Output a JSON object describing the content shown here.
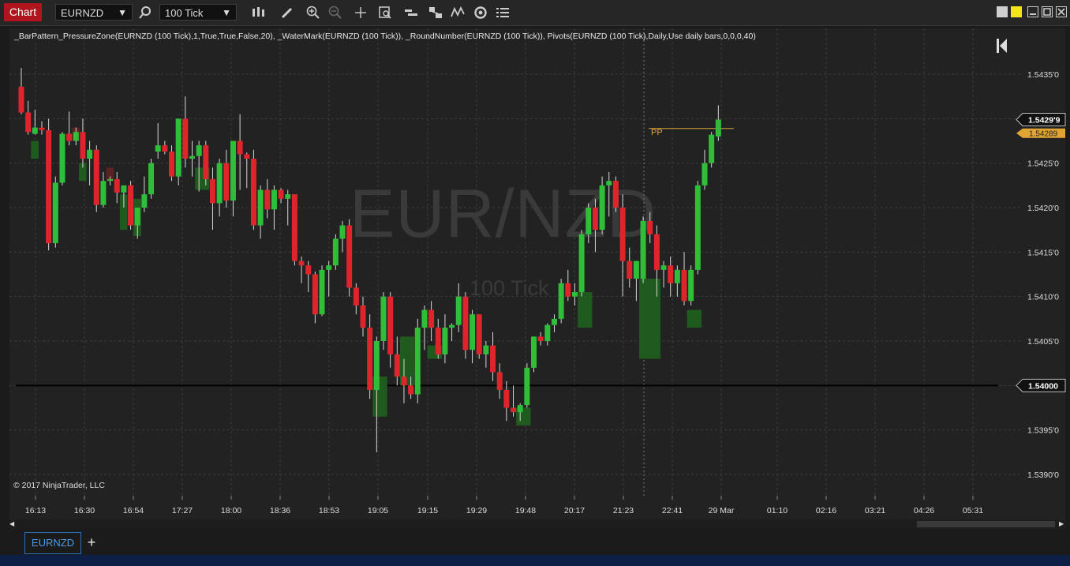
{
  "toolbar": {
    "chart_tab_label": "Chart",
    "instrument": "EURNZD",
    "interval": "100 Tick",
    "icons": [
      "search-icon",
      "bar-type-icon",
      "pencil-icon",
      "zoom-in-icon",
      "zoom-out-icon",
      "crosshair-icon",
      "data-box-icon",
      "indicators-icon",
      "strategies-icon",
      "chart-trader-icon",
      "refresh-icon",
      "properties-icon"
    ]
  },
  "chart": {
    "indicator_line": "_BarPattern_PressureZone(EURNZD (100 Tick),1,True,True,False,20), _WaterMark(EURNZD (100 Tick)), _RoundNumber(EURNZD (100 Tick)), Pivots(EURNZD (100 Tick),Daily,Use daily bars,0,0,0,40)",
    "watermark_symbol": "EUR/NZD",
    "watermark_interval": "100 Tick",
    "copyright": "© 2017 NinjaTrader, LLC",
    "pivot_label": "PP",
    "price_labels": [
      "1.5435'0",
      "1.5425'0",
      "1.5420'0",
      "1.5415'0",
      "1.5410'0",
      "1.5405'0",
      "1.5395'0",
      "1.5390'0"
    ],
    "current_price_label": "1.5429'9",
    "pivot_price_label": "1.54289",
    "round_number_label": "1.54000",
    "time_labels": [
      "16:13",
      "16:30",
      "16:54",
      "17:27",
      "18:00",
      "18:36",
      "18:53",
      "19:05",
      "19:15",
      "19:29",
      "19:48",
      "20:17",
      "21:23",
      "22:41",
      "29 Mar",
      "01:10",
      "02:16",
      "03:21",
      "04:26",
      "05:31"
    ],
    "colors": {
      "up": "#2fbe3a",
      "down": "#e0242b",
      "zone_up": "#1f5a1f",
      "zone_down": "#5a2222",
      "pivot": "#e0a533",
      "round_number": "#000000"
    }
  },
  "chart_data": {
    "type": "candlestick",
    "ylim": [
      1.5387,
      1.544
    ],
    "candles": [
      {
        "o": 1.54336,
        "h": 1.54357,
        "l": 1.54305,
        "c": 1.54307
      },
      {
        "o": 1.54307,
        "h": 1.5432,
        "l": 1.54282,
        "c": 1.54285
      },
      {
        "o": 1.54283,
        "h": 1.5431,
        "l": 1.54282,
        "c": 1.5429
      },
      {
        "o": 1.5429,
        "h": 1.54297,
        "l": 1.54282,
        "c": 1.54287
      },
      {
        "o": 1.54287,
        "h": 1.543,
        "l": 1.54152,
        "c": 1.5416
      },
      {
        "o": 1.5416,
        "h": 1.54235,
        "l": 1.54155,
        "c": 1.54228
      },
      {
        "o": 1.54228,
        "h": 1.54285,
        "l": 1.54225,
        "c": 1.54283
      },
      {
        "o": 1.54283,
        "h": 1.54308,
        "l": 1.5427,
        "c": 1.54275
      },
      {
        "o": 1.54275,
        "h": 1.5429,
        "l": 1.5427,
        "c": 1.54285
      },
      {
        "o": 1.54285,
        "h": 1.543,
        "l": 1.54245,
        "c": 1.54255
      },
      {
        "o": 1.54255,
        "h": 1.54275,
        "l": 1.54225,
        "c": 1.54265
      },
      {
        "o": 1.54265,
        "h": 1.5427,
        "l": 1.54195,
        "c": 1.54203
      },
      {
        "o": 1.54203,
        "h": 1.5424,
        "l": 1.542,
        "c": 1.5423
      },
      {
        "o": 1.5423,
        "h": 1.54235,
        "l": 1.54225,
        "c": 1.54232
      },
      {
        "o": 1.54232,
        "h": 1.5424,
        "l": 1.54205,
        "c": 1.54217
      },
      {
        "o": 1.54217,
        "h": 1.54225,
        "l": 1.542,
        "c": 1.54225
      },
      {
        "o": 1.54225,
        "h": 1.5423,
        "l": 1.54175,
        "c": 1.5418
      },
      {
        "o": 1.5418,
        "h": 1.542,
        "l": 1.54165,
        "c": 1.542
      },
      {
        "o": 1.542,
        "h": 1.54235,
        "l": 1.54195,
        "c": 1.54215
      },
      {
        "o": 1.54215,
        "h": 1.54255,
        "l": 1.5421,
        "c": 1.5425
      },
      {
        "o": 1.54263,
        "h": 1.54295,
        "l": 1.54255,
        "c": 1.5427
      },
      {
        "o": 1.5427,
        "h": 1.54275,
        "l": 1.5426,
        "c": 1.54263
      },
      {
        "o": 1.54263,
        "h": 1.5427,
        "l": 1.5423,
        "c": 1.54235
      },
      {
        "o": 1.54235,
        "h": 1.543,
        "l": 1.54225,
        "c": 1.543
      },
      {
        "o": 1.543,
        "h": 1.54325,
        "l": 1.54245,
        "c": 1.54255
      },
      {
        "o": 1.54255,
        "h": 1.54275,
        "l": 1.54235,
        "c": 1.54258
      },
      {
        "o": 1.54258,
        "h": 1.54275,
        "l": 1.54218,
        "c": 1.5427
      },
      {
        "o": 1.5427,
        "h": 1.54275,
        "l": 1.54225,
        "c": 1.54232
      },
      {
        "o": 1.54232,
        "h": 1.54245,
        "l": 1.54175,
        "c": 1.54205
      },
      {
        "o": 1.54205,
        "h": 1.54255,
        "l": 1.5419,
        "c": 1.5425
      },
      {
        "o": 1.5425,
        "h": 1.54265,
        "l": 1.542,
        "c": 1.54208
      },
      {
        "o": 1.54208,
        "h": 1.54275,
        "l": 1.5419,
        "c": 1.54275
      },
      {
        "o": 1.54275,
        "h": 1.54305,
        "l": 1.5422,
        "c": 1.5426
      },
      {
        "o": 1.5426,
        "h": 1.54262,
        "l": 1.54222,
        "c": 1.54255
      },
      {
        "o": 1.54255,
        "h": 1.54265,
        "l": 1.54175,
        "c": 1.5418
      },
      {
        "o": 1.5418,
        "h": 1.54225,
        "l": 1.54165,
        "c": 1.5422
      },
      {
        "o": 1.5422,
        "h": 1.54232,
        "l": 1.54188,
        "c": 1.54198
      },
      {
        "o": 1.54198,
        "h": 1.54225,
        "l": 1.54175,
        "c": 1.5422
      },
      {
        "o": 1.5422,
        "h": 1.54222,
        "l": 1.54205,
        "c": 1.5421
      },
      {
        "o": 1.5421,
        "h": 1.5422,
        "l": 1.5418,
        "c": 1.54215
      },
      {
        "o": 1.54215,
        "h": 1.5421,
        "l": 1.54135,
        "c": 1.5414
      },
      {
        "o": 1.5414,
        "h": 1.54145,
        "l": 1.54115,
        "c": 1.54135
      },
      {
        "o": 1.54135,
        "h": 1.5414,
        "l": 1.54105,
        "c": 1.54125
      },
      {
        "o": 1.54125,
        "h": 1.54128,
        "l": 1.5407,
        "c": 1.5408
      },
      {
        "o": 1.5408,
        "h": 1.54135,
        "l": 1.54078,
        "c": 1.5413
      },
      {
        "o": 1.5413,
        "h": 1.5414,
        "l": 1.541,
        "c": 1.54135
      },
      {
        "o": 1.54135,
        "h": 1.5417,
        "l": 1.5413,
        "c": 1.54165
      },
      {
        "o": 1.54165,
        "h": 1.54185,
        "l": 1.5415,
        "c": 1.5418
      },
      {
        "o": 1.5418,
        "h": 1.54187,
        "l": 1.541,
        "c": 1.5411
      },
      {
        "o": 1.5411,
        "h": 1.54115,
        "l": 1.5408,
        "c": 1.5409
      },
      {
        "o": 1.5409,
        "h": 1.541,
        "l": 1.54055,
        "c": 1.54065
      },
      {
        "o": 1.54065,
        "h": 1.5408,
        "l": 1.53985,
        "c": 1.53995
      },
      {
        "o": 1.53995,
        "h": 1.54055,
        "l": 1.53925,
        "c": 1.5405
      },
      {
        "o": 1.5405,
        "h": 1.54105,
        "l": 1.5404,
        "c": 1.541
      },
      {
        "o": 1.541,
        "h": 1.54105,
        "l": 1.5402,
        "c": 1.54035
      },
      {
        "o": 1.54035,
        "h": 1.54055,
        "l": 1.54,
        "c": 1.5401
      },
      {
        "o": 1.5401,
        "h": 1.5403,
        "l": 1.5398,
        "c": 1.54
      },
      {
        "o": 1.54,
        "h": 1.5401,
        "l": 1.53985,
        "c": 1.5399
      },
      {
        "o": 1.5399,
        "h": 1.54075,
        "l": 1.5398,
        "c": 1.54065
      },
      {
        "o": 1.54065,
        "h": 1.5409,
        "l": 1.5404,
        "c": 1.54085
      },
      {
        "o": 1.54085,
        "h": 1.54095,
        "l": 1.5405,
        "c": 1.54065
      },
      {
        "o": 1.54065,
        "h": 1.54075,
        "l": 1.5403,
        "c": 1.54035
      },
      {
        "o": 1.54035,
        "h": 1.5408,
        "l": 1.54025,
        "c": 1.54065
      },
      {
        "o": 1.54065,
        "h": 1.5407,
        "l": 1.5405,
        "c": 1.54068
      },
      {
        "o": 1.54068,
        "h": 1.54115,
        "l": 1.5406,
        "c": 1.541
      },
      {
        "o": 1.541,
        "h": 1.54105,
        "l": 1.5403,
        "c": 1.5404
      },
      {
        "o": 1.5404,
        "h": 1.54085,
        "l": 1.54025,
        "c": 1.5408
      },
      {
        "o": 1.5408,
        "h": 1.54045,
        "l": 1.5403,
        "c": 1.54035
      },
      {
        "o": 1.54035,
        "h": 1.5405,
        "l": 1.5402,
        "c": 1.54045
      },
      {
        "o": 1.54045,
        "h": 1.5406,
        "l": 1.54005,
        "c": 1.54015
      },
      {
        "o": 1.54015,
        "h": 1.54025,
        "l": 1.53985,
        "c": 1.53995
      },
      {
        "o": 1.53995,
        "h": 1.54005,
        "l": 1.5396,
        "c": 1.53975
      },
      {
        "o": 1.53975,
        "h": 1.54,
        "l": 1.53965,
        "c": 1.5397
      },
      {
        "o": 1.5397,
        "h": 1.5398,
        "l": 1.5396,
        "c": 1.53978
      },
      {
        "o": 1.53978,
        "h": 1.54025,
        "l": 1.53975,
        "c": 1.5402
      },
      {
        "o": 1.5402,
        "h": 1.54055,
        "l": 1.54015,
        "c": 1.54055
      },
      {
        "o": 1.54055,
        "h": 1.5406,
        "l": 1.54045,
        "c": 1.5405
      },
      {
        "o": 1.5405,
        "h": 1.5407,
        "l": 1.54045,
        "c": 1.54068
      },
      {
        "o": 1.54068,
        "h": 1.5408,
        "l": 1.5406,
        "c": 1.54075
      },
      {
        "o": 1.54075,
        "h": 1.5412,
        "l": 1.5407,
        "c": 1.54115
      },
      {
        "o": 1.54115,
        "h": 1.5413,
        "l": 1.54095,
        "c": 1.541
      },
      {
        "o": 1.541,
        "h": 1.54115,
        "l": 1.5409,
        "c": 1.54105
      },
      {
        "o": 1.54105,
        "h": 1.54175,
        "l": 1.541,
        "c": 1.5417
      },
      {
        "o": 1.5417,
        "h": 1.54205,
        "l": 1.5416,
        "c": 1.542
      },
      {
        "o": 1.542,
        "h": 1.5421,
        "l": 1.5415,
        "c": 1.54175
      },
      {
        "o": 1.54175,
        "h": 1.54235,
        "l": 1.5417,
        "c": 1.54225
      },
      {
        "o": 1.54225,
        "h": 1.5424,
        "l": 1.5419,
        "c": 1.5423
      },
      {
        "o": 1.5423,
        "h": 1.54235,
        "l": 1.54195,
        "c": 1.542
      },
      {
        "o": 1.542,
        "h": 1.54215,
        "l": 1.541,
        "c": 1.5414
      },
      {
        "o": 1.5414,
        "h": 1.54155,
        "l": 1.5411,
        "c": 1.5412
      },
      {
        "o": 1.5412,
        "h": 1.5414,
        "l": 1.54095,
        "c": 1.5414
      },
      {
        "o": 1.5412,
        "h": 1.5419,
        "l": 1.54115,
        "c": 1.54185
      },
      {
        "o": 1.54185,
        "h": 1.54195,
        "l": 1.5416,
        "c": 1.5417
      },
      {
        "o": 1.5417,
        "h": 1.5418,
        "l": 1.541,
        "c": 1.5413
      },
      {
        "o": 1.5413,
        "h": 1.5414,
        "l": 1.5411,
        "c": 1.54135
      },
      {
        "o": 1.54135,
        "h": 1.54145,
        "l": 1.541,
        "c": 1.54115
      },
      {
        "o": 1.54115,
        "h": 1.54135,
        "l": 1.541,
        "c": 1.5413
      },
      {
        "o": 1.5413,
        "h": 1.5415,
        "l": 1.5409,
        "c": 1.54095
      },
      {
        "o": 1.54095,
        "h": 1.54135,
        "l": 1.5409,
        "c": 1.5413
      },
      {
        "o": 1.5413,
        "h": 1.5423,
        "l": 1.54125,
        "c": 1.54225
      },
      {
        "o": 1.54225,
        "h": 1.54265,
        "l": 1.5422,
        "c": 1.5425
      },
      {
        "o": 1.5425,
        "h": 1.54285,
        "l": 1.54245,
        "c": 1.54282
      },
      {
        "o": 1.5428,
        "h": 1.54315,
        "l": 1.54275,
        "c": 1.54299
      }
    ]
  }
}
